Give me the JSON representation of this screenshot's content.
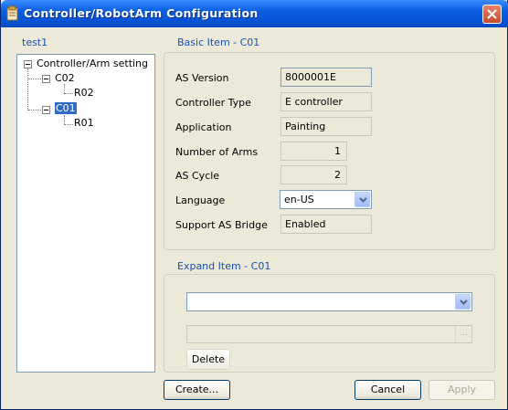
{
  "window": {
    "title": "Controller/RobotArm Configuration",
    "icons": {
      "app": "app-window-icon",
      "close": "close-icon"
    }
  },
  "tree": {
    "caption": "test1",
    "root": "Controller/Arm setting",
    "controllers": [
      {
        "label": "C02",
        "arm": "R02",
        "selected": false
      },
      {
        "label": "C01",
        "arm": "R01",
        "selected": true
      }
    ]
  },
  "basic": {
    "caption": "Basic Item - C01",
    "as_version_label": "AS Version",
    "as_version": "8000001E",
    "controller_type_label": "Controller Type",
    "controller_type": "E controller",
    "application_label": "Application",
    "application": "Painting",
    "num_arms_label": "Number of Arms",
    "num_arms": "1",
    "as_cycle_label": "AS Cycle",
    "as_cycle": "2",
    "language_label": "Language",
    "language": "en-US",
    "support_bridge_label": "Support AS Bridge",
    "support_bridge": "Enabled"
  },
  "expand": {
    "caption": "Expand Item - C01",
    "select_value": "",
    "path_value": "",
    "ellipsis_label": "...",
    "delete_label": "Delete"
  },
  "footer": {
    "create_label": "Create...",
    "cancel_label": "Cancel",
    "apply_label": "Apply"
  },
  "colors": {
    "title_bar": "#0653d4",
    "caption_blue": "#1652b4",
    "selection": "#316ac5",
    "window_bg": "#ece9d8"
  }
}
